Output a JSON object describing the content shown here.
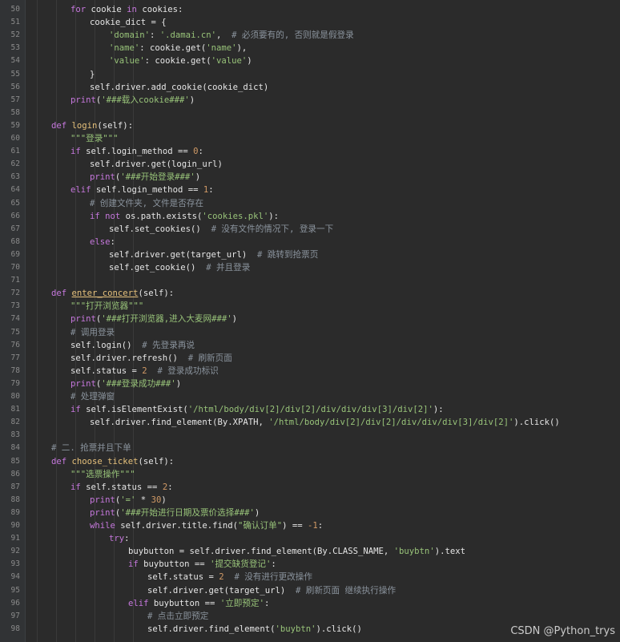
{
  "editor": {
    "lines": [
      {
        "n": "50",
        "indent": 2,
        "tokens": [
          [
            "kw",
            "for"
          ],
          [
            "p",
            " cookie "
          ],
          [
            "kw",
            "in"
          ],
          [
            "p",
            " cookies:"
          ]
        ]
      },
      {
        "n": "51",
        "indent": 3,
        "tokens": [
          [
            "p",
            "cookie_dict = {"
          ]
        ]
      },
      {
        "n": "52",
        "indent": 4,
        "tokens": [
          [
            "str",
            "'domain'"
          ],
          [
            "p",
            ": "
          ],
          [
            "str",
            "'.damai.cn'"
          ],
          [
            "p",
            ",  "
          ],
          [
            "cm",
            "# 必须要有的, 否则就是假登录"
          ]
        ]
      },
      {
        "n": "53",
        "indent": 4,
        "tokens": [
          [
            "str",
            "'name'"
          ],
          [
            "p",
            ": cookie.get("
          ],
          [
            "str",
            "'name'"
          ],
          [
            "p",
            "),"
          ]
        ]
      },
      {
        "n": "54",
        "indent": 4,
        "tokens": [
          [
            "str",
            "'value'"
          ],
          [
            "p",
            ": cookie.get("
          ],
          [
            "str",
            "'value'"
          ],
          [
            "p",
            ")"
          ]
        ]
      },
      {
        "n": "55",
        "indent": 3,
        "tokens": [
          [
            "p",
            "}"
          ]
        ]
      },
      {
        "n": "56",
        "indent": 3,
        "tokens": [
          [
            "p",
            "self.driver.add_cookie(cookie_dict)"
          ]
        ]
      },
      {
        "n": "57",
        "indent": 2,
        "tokens": [
          [
            "kw",
            "print"
          ],
          [
            "p",
            "("
          ],
          [
            "str",
            "'###载入cookie###'"
          ],
          [
            "p",
            ")"
          ]
        ]
      },
      {
        "n": "58",
        "indent": 0,
        "tokens": []
      },
      {
        "n": "59",
        "indent": 1,
        "tokens": [
          [
            "kw",
            "def"
          ],
          [
            "p",
            " "
          ],
          [
            "fn",
            "login"
          ],
          [
            "p",
            "(self):"
          ]
        ]
      },
      {
        "n": "60",
        "indent": 2,
        "tokens": [
          [
            "doc",
            "\"\"\"登录\"\"\""
          ]
        ]
      },
      {
        "n": "61",
        "indent": 2,
        "tokens": [
          [
            "kw",
            "if"
          ],
          [
            "p",
            " self.login_method "
          ],
          [
            "p",
            "== "
          ],
          [
            "num",
            "0"
          ],
          [
            "p",
            ":"
          ]
        ]
      },
      {
        "n": "62",
        "indent": 3,
        "tokens": [
          [
            "p",
            "self.driver.get(login_url)"
          ]
        ]
      },
      {
        "n": "63",
        "indent": 3,
        "tokens": [
          [
            "kw",
            "print"
          ],
          [
            "p",
            "("
          ],
          [
            "str",
            "'###开始登录###'"
          ],
          [
            "p",
            ")"
          ]
        ]
      },
      {
        "n": "64",
        "indent": 2,
        "tokens": [
          [
            "kw",
            "elif"
          ],
          [
            "p",
            " self.login_method == "
          ],
          [
            "num",
            "1"
          ],
          [
            "p",
            ":"
          ]
        ]
      },
      {
        "n": "65",
        "indent": 3,
        "tokens": [
          [
            "cm",
            "# 创建文件夹, 文件是否存在"
          ]
        ]
      },
      {
        "n": "66",
        "indent": 3,
        "tokens": [
          [
            "kw",
            "if not"
          ],
          [
            "p",
            " os.path.exists("
          ],
          [
            "str",
            "'cookies.pkl'"
          ],
          [
            "p",
            "):"
          ]
        ]
      },
      {
        "n": "67",
        "indent": 4,
        "tokens": [
          [
            "p",
            "self.set_cookies()  "
          ],
          [
            "cm",
            "# 没有文件的情况下, 登录一下"
          ]
        ]
      },
      {
        "n": "68",
        "indent": 3,
        "tokens": [
          [
            "kw",
            "else"
          ],
          [
            "p",
            ":"
          ]
        ]
      },
      {
        "n": "69",
        "indent": 4,
        "tokens": [
          [
            "p",
            "self.driver.get(target_url)  "
          ],
          [
            "cm",
            "# 跳转到抢票页"
          ]
        ]
      },
      {
        "n": "70",
        "indent": 4,
        "tokens": [
          [
            "p",
            "self.get_cookie()  "
          ],
          [
            "cm",
            "# 并且登录"
          ]
        ]
      },
      {
        "n": "71",
        "indent": 0,
        "tokens": []
      },
      {
        "n": "72",
        "indent": 1,
        "tokens": [
          [
            "kw",
            "def"
          ],
          [
            "p",
            " "
          ],
          [
            "fnu",
            "enter_concert"
          ],
          [
            "p",
            "(self):"
          ]
        ]
      },
      {
        "n": "73",
        "indent": 2,
        "tokens": [
          [
            "doc",
            "\"\"\"打开浏览器\"\"\""
          ]
        ]
      },
      {
        "n": "74",
        "indent": 2,
        "tokens": [
          [
            "kw",
            "print"
          ],
          [
            "p",
            "("
          ],
          [
            "str",
            "'###打开浏览器,进入大麦网###'"
          ],
          [
            "p",
            ")"
          ]
        ]
      },
      {
        "n": "75",
        "indent": 2,
        "tokens": [
          [
            "cm",
            "# 调用登录"
          ]
        ]
      },
      {
        "n": "76",
        "indent": 2,
        "tokens": [
          [
            "p",
            "self.login()  "
          ],
          [
            "cm",
            "# 先登录再说"
          ]
        ]
      },
      {
        "n": "77",
        "indent": 2,
        "tokens": [
          [
            "p",
            "self.driver.refresh()  "
          ],
          [
            "cm",
            "# 刷新页面"
          ]
        ]
      },
      {
        "n": "78",
        "indent": 2,
        "tokens": [
          [
            "p",
            "self.status = "
          ],
          [
            "num",
            "2"
          ],
          [
            "p",
            "  "
          ],
          [
            "cm",
            "# 登录成功标识"
          ]
        ]
      },
      {
        "n": "79",
        "indent": 2,
        "tokens": [
          [
            "kw",
            "print"
          ],
          [
            "p",
            "("
          ],
          [
            "str",
            "'###登录成功###'"
          ],
          [
            "p",
            ")"
          ]
        ]
      },
      {
        "n": "80",
        "indent": 2,
        "tokens": [
          [
            "cm",
            "# 处理弹窗"
          ]
        ]
      },
      {
        "n": "81",
        "indent": 2,
        "tokens": [
          [
            "kw",
            "if"
          ],
          [
            "p",
            " self.isElementExist("
          ],
          [
            "str",
            "'/html/body/div[2]/div[2]/div/div/div[3]/div[2]'"
          ],
          [
            "p",
            "):"
          ]
        ]
      },
      {
        "n": "82",
        "indent": 3,
        "tokens": [
          [
            "p",
            "self.driver.find_element(By.XPATH, "
          ],
          [
            "str",
            "'/html/body/div[2]/div[2]/div/div/div[3]/div[2]'"
          ],
          [
            "p",
            ").click()"
          ]
        ]
      },
      {
        "n": "83",
        "indent": 0,
        "tokens": []
      },
      {
        "n": "84",
        "indent": 1,
        "tokens": [
          [
            "cm",
            "# 二. 抢票并且下单"
          ]
        ]
      },
      {
        "n": "85",
        "indent": 1,
        "tokens": [
          [
            "kw",
            "def"
          ],
          [
            "p",
            " "
          ],
          [
            "fn",
            "choose_ticket"
          ],
          [
            "p",
            "(self):"
          ]
        ]
      },
      {
        "n": "86",
        "indent": 2,
        "tokens": [
          [
            "doc",
            "\"\"\"选票操作\"\"\""
          ]
        ]
      },
      {
        "n": "87",
        "indent": 2,
        "tokens": [
          [
            "kw",
            "if"
          ],
          [
            "p",
            " self.status == "
          ],
          [
            "num",
            "2"
          ],
          [
            "p",
            ":"
          ]
        ]
      },
      {
        "n": "88",
        "indent": 3,
        "tokens": [
          [
            "kw",
            "print"
          ],
          [
            "p",
            "("
          ],
          [
            "str",
            "'='"
          ],
          [
            "p",
            " * "
          ],
          [
            "num",
            "30"
          ],
          [
            "p",
            ")"
          ]
        ]
      },
      {
        "n": "89",
        "indent": 3,
        "tokens": [
          [
            "kw",
            "print"
          ],
          [
            "p",
            "("
          ],
          [
            "str",
            "'###开始进行日期及票价选择###'"
          ],
          [
            "p",
            ")"
          ]
        ]
      },
      {
        "n": "90",
        "indent": 3,
        "tokens": [
          [
            "kw",
            "while"
          ],
          [
            "p",
            " self.driver.title.find("
          ],
          [
            "str",
            "\"确认订单\""
          ],
          [
            "p",
            ") == "
          ],
          [
            "num",
            "-1"
          ],
          [
            "p",
            ":"
          ]
        ]
      },
      {
        "n": "91",
        "indent": 4,
        "tokens": [
          [
            "kw",
            "try"
          ],
          [
            "p",
            ":"
          ]
        ]
      },
      {
        "n": "92",
        "indent": 5,
        "tokens": [
          [
            "p",
            "buybutton = self.driver.find_element(By.CLASS_NAME, "
          ],
          [
            "str",
            "'buybtn'"
          ],
          [
            "p",
            ").text"
          ]
        ]
      },
      {
        "n": "93",
        "indent": 5,
        "tokens": [
          [
            "kw",
            "if"
          ],
          [
            "p",
            " buybutton == "
          ],
          [
            "str",
            "'提交缺货登记'"
          ],
          [
            "p",
            ":"
          ]
        ]
      },
      {
        "n": "94",
        "indent": 6,
        "tokens": [
          [
            "p",
            "self.status = "
          ],
          [
            "num",
            "2"
          ],
          [
            "p",
            "  "
          ],
          [
            "cm",
            "# 没有进行更改操作"
          ]
        ]
      },
      {
        "n": "95",
        "indent": 6,
        "tokens": [
          [
            "p",
            "self.driver.get(target_url)  "
          ],
          [
            "cm",
            "# 刷新页面 继续执行操作"
          ]
        ]
      },
      {
        "n": "96",
        "indent": 5,
        "tokens": [
          [
            "kw",
            "elif"
          ],
          [
            "p",
            " buybutton == "
          ],
          [
            "str",
            "'立即预定'"
          ],
          [
            "p",
            ":"
          ]
        ]
      },
      {
        "n": "97",
        "indent": 6,
        "tokens": [
          [
            "cm",
            "# 点击立即预定"
          ]
        ]
      },
      {
        "n": "98",
        "indent": 6,
        "tokens": [
          [
            "p",
            "self.driver.find_element("
          ],
          [
            "str",
            "'buybtn'"
          ],
          [
            "p",
            ").click()"
          ]
        ]
      }
    ]
  },
  "watermark": {
    "text": "CSDN @Python_trys"
  },
  "colors": {
    "background": "#2b2b2b",
    "keyword": "#c678dd",
    "function": "#e5c07b",
    "string": "#98c379",
    "number": "#d19a66",
    "comment": "#8b949e"
  }
}
